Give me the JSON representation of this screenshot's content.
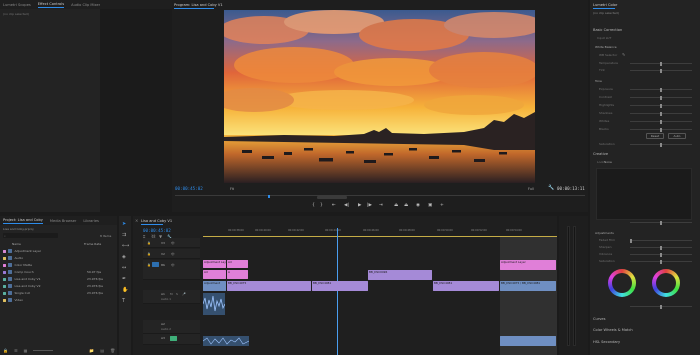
{
  "left_panel": {
    "tabs": [
      "Lumetri Scopes",
      "Effect Controls",
      "Audio Clip Mixer: Lisa and Coby V1"
    ],
    "active_tab": 1,
    "empty_message": "(no clip selected)"
  },
  "program_monitor": {
    "title": "Program: Lisa and Coby V1",
    "timecode_current": "00:00:45:02",
    "zoom": "Fit",
    "quality": "Full",
    "timecode_duration": "00:00:13:11"
  },
  "lumetri": {
    "title": "Lumetri Color",
    "clip_label": "(no clip selected)",
    "sections": {
      "basic": "Basic Correction",
      "white_balance": "White Balance",
      "tone": "Tone",
      "creative": "Creative",
      "adjustments": "Adjustments",
      "curves": "Curves",
      "color_wheels": "Color Wheels & Match",
      "hsl": "HSL Secondary"
    },
    "basic_rows": [
      "Input LUT",
      "WB Selector",
      "Temperature",
      "Tint",
      "Exposure",
      "Contrast",
      "Highlights",
      "Shadows",
      "Whites",
      "Blacks",
      "Saturation"
    ],
    "adjust_rows": [
      "Faded Film",
      "Sharpen",
      "Vibrance",
      "Saturation",
      "Tint Balance"
    ],
    "buttons": [
      "Reset",
      "Auto"
    ],
    "look_label": "Look",
    "look_value": "None"
  },
  "project": {
    "tabs": [
      "Project: Lisa and Coby",
      "Media Browser",
      "Libraries"
    ],
    "active_tab": 0,
    "file_name": "Lisa and Coby.prproj",
    "item_count": "8 Items",
    "columns": [
      "Name",
      "Frame Rate"
    ],
    "items": [
      {
        "name": "Adjustment Layer",
        "rate": "",
        "color": "#d98ad4"
      },
      {
        "name": "Audio",
        "rate": "",
        "color": "#e0c060"
      },
      {
        "name": "Color Matte",
        "rate": "",
        "color": "#e07fd8"
      },
      {
        "name": "Comp Couch",
        "rate": "59.97 fps",
        "color": "#9a7ad8"
      },
      {
        "name": "Lisa and Coby V1",
        "rate": "23.976 fps",
        "color": "#5ab0a0"
      },
      {
        "name": "Lisa and Coby V2",
        "rate": "23.976 fps",
        "color": "#5ab0a0"
      },
      {
        "name": "Single Cut",
        "rate": "23.976 fps",
        "color": "#5ab0a0"
      },
      {
        "name": "Video",
        "rate": "",
        "color": "#e0c060"
      }
    ]
  },
  "timeline": {
    "title": "Lisa and Coby V1",
    "timecode": "00:00:45:02",
    "ruler": [
      "00:00:38:00",
      "00:00:40:00",
      "00:00:42:00",
      "00:00:44:00",
      "00:00:46:00",
      "00:00:48:00",
      "00:00:50:00",
      "00:00:52:00",
      "00:00:54:00"
    ],
    "tracks": [
      "V3",
      "V2",
      "V1",
      "A1",
      "A2",
      "A3"
    ],
    "track_names": [
      "",
      "",
      "",
      "Audio 1",
      "Audio 2",
      ""
    ],
    "clips": {
      "v3a": "Adjustment Layer",
      "v3b": "Ad",
      "v3c": "Adjustment Layer",
      "v2a": "Ad",
      "v2b": "A",
      "v2c": "BB_DSC0496",
      "v1a": "Adjustment",
      "v1b": "BB_DSC4975",
      "v1c": "BB_DSC4981",
      "v1d": "BB_DSC4981",
      "v1e": "BB_DSC4975 / BB_DSC4981"
    }
  },
  "colors": {
    "accent": "#2d8ceb",
    "playhead": "#4a9ef0",
    "work_area": "#e8c94a"
  }
}
